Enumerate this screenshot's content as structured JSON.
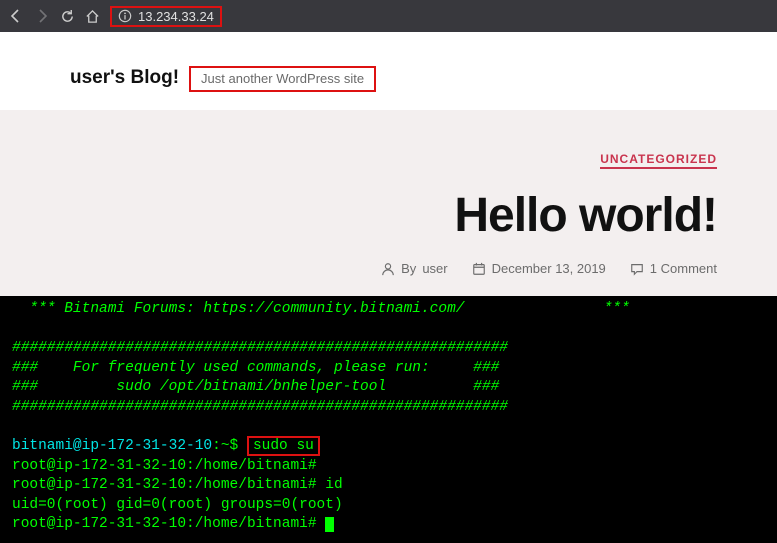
{
  "browser": {
    "address": "13.234.33.24"
  },
  "blog": {
    "title": "user's Blog!",
    "tagline": "Just another WordPress site",
    "category": "UNCATEGORIZED",
    "post_title": "Hello world!",
    "author_prefix": "By",
    "author": "user",
    "date": "December 13, 2019",
    "comments": "1 Comment"
  },
  "terminal": {
    "forums_line": "  *** Bitnami Forums: https://community.bitnami.com/                ***",
    "bar": "#########################################################",
    "hint1": "###    For frequently used commands, please run:     ###",
    "hint2": "###         sudo /opt/bitnami/bnhelper-tool          ###",
    "prompt1_user": "bitnami@ip-172-31-32-10",
    "prompt1_path": ":~$ ",
    "sudo_cmd": "sudo su",
    "root_prompt": "root@ip-172-31-32-10:/home/bitnami#",
    "id_cmd": " id",
    "id_out": "uid=0(root) gid=0(root) groups=0(root)"
  }
}
